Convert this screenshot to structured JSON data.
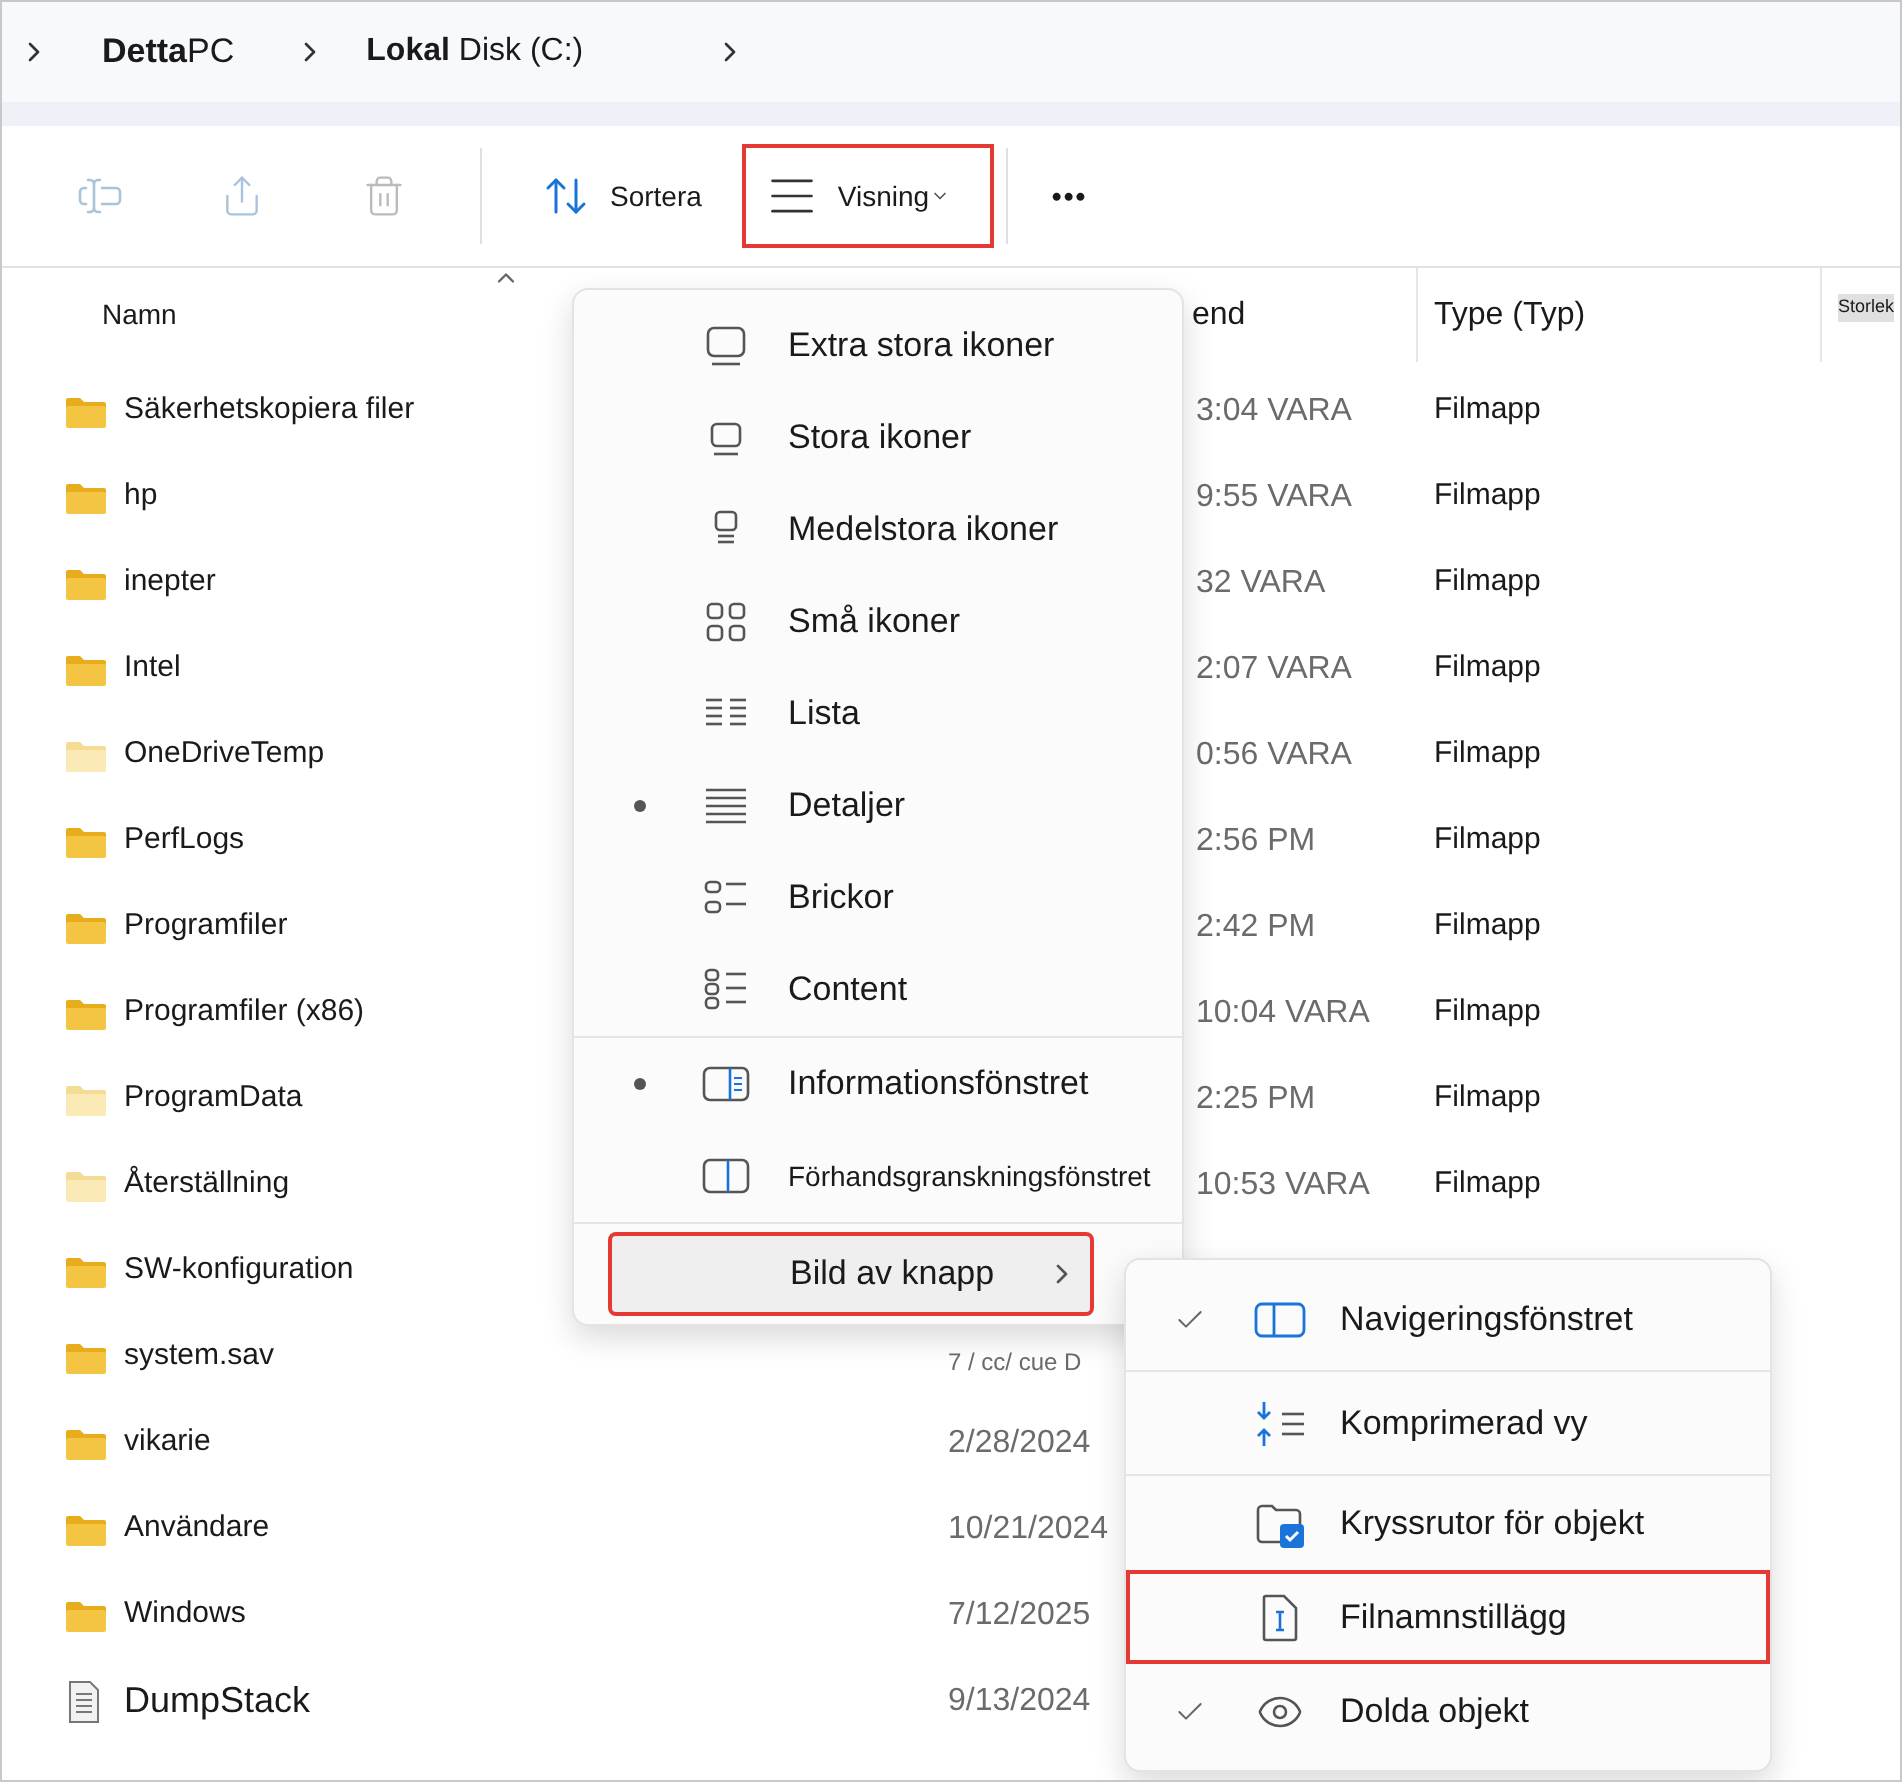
{
  "breadcrumb": [
    {
      "label": "**Detta**PC"
    },
    {
      "label": "**Lokal** Disk (C:)"
    }
  ],
  "toolbar": [
    {
      "kind": "rename",
      "disabled": true
    },
    {
      "kind": "share",
      "disabled": true
    },
    {
      "kind": "delete",
      "disabled": true
    },
    {
      "kind": "sort",
      "label": "Sortera",
      "highlighted": false
    },
    {
      "kind": "view",
      "label": "Visning",
      "highlighted": true
    },
    {
      "kind": "more",
      "label": "•••"
    }
  ],
  "table": {
    "columns": [
      "Namn",
      "end",
      "Type (Typ)",
      "Storlek"
    ],
    "rows": [
      {
        "kind": "folder",
        "hidden": false,
        "name": "Säkerhetskopiera filer",
        "date": "3:04 VARA",
        "type": "Filmapp"
      },
      {
        "kind": "folder",
        "hidden": false,
        "name": "hp",
        "date": "9:55 VARA",
        "type": "Filmapp"
      },
      {
        "kind": "folder",
        "hidden": false,
        "name": "inepter",
        "date": "32 VARA",
        "type": "Filmapp"
      },
      {
        "kind": "folder",
        "hidden": false,
        "name": "Intel",
        "date": "2:07 VARA",
        "type": "Filmapp"
      },
      {
        "kind": "folder",
        "hidden": true,
        "name": "OneDriveTemp",
        "date": "0:56 VARA",
        "type": "Filmapp"
      },
      {
        "kind": "folder",
        "hidden": false,
        "name": "PerfLogs",
        "date": "2:56 PM",
        "type": "Filmapp"
      },
      {
        "kind": "folder",
        "hidden": false,
        "name": "Programfiler",
        "date": "2:42 PM",
        "type": "Filmapp"
      },
      {
        "kind": "folder",
        "hidden": false,
        "name": "Programfiler (x86)",
        "date": "10:04 VARA",
        "type": "Filmapp"
      },
      {
        "kind": "folder",
        "hidden": true,
        "name": "ProgramData",
        "date": "2:25 PM",
        "type": "Filmapp"
      },
      {
        "kind": "folder",
        "hidden": true,
        "name": "Återställning",
        "date": "10:53 VARA",
        "type": "Filmapp"
      },
      {
        "kind": "folder",
        "hidden": false,
        "name": "SW-konfiguration"
      },
      {
        "kind": "folder",
        "hidden": false,
        "name": "system.sav",
        "date": "7 / cc/ cue D"
      },
      {
        "kind": "folder",
        "hidden": false,
        "name": "vikarie",
        "date": "2/28/2024"
      },
      {
        "kind": "folder",
        "hidden": false,
        "name": "Användare",
        "date": "10/21/2024"
      },
      {
        "kind": "folder",
        "hidden": false,
        "name": "Windows",
        "date": "7/12/2025"
      },
      {
        "kind": "file",
        "hidden": false,
        "name": "DumpStack",
        "date": "9/13/2024"
      }
    ]
  },
  "view_menu": {
    "sections": [
      {
        "items": [
          {
            "label": "Extra stora ikoner",
            "selected": false
          },
          {
            "label": "Stora ikoner",
            "selected": false
          },
          {
            "label": "Medelstora ikoner",
            "selected": false
          },
          {
            "label": "Små ikoner",
            "selected": false
          },
          {
            "label": "Lista",
            "selected": false
          },
          {
            "label": "Detaljer",
            "selected": true
          },
          {
            "label": "Brickor",
            "selected": false
          },
          {
            "label": "Content",
            "selected": false
          }
        ]
      },
      {
        "items": [
          {
            "label": "Informationsfönstret",
            "selected": true
          },
          {
            "label": "Förhandsgranskningsfönstret",
            "selected": false
          }
        ]
      }
    ],
    "show_item": {
      "label": "Bild av knapp",
      "highlighted": true
    }
  },
  "show_menu": {
    "sections": [
      {
        "items": [
          {
            "label": "Navigeringsfönstret",
            "checked": true,
            "highlighted": false
          }
        ]
      },
      {
        "items": [
          {
            "label": "Komprimerad vy",
            "checked": false,
            "highlighted": false
          }
        ]
      },
      {
        "items": [
          {
            "label": "Kryssrutor för objekt",
            "checked": false,
            "highlighted": false
          },
          {
            "label": "Filnamnstillägg",
            "checked": false,
            "highlighted": true
          },
          {
            "label": "Dolda objekt",
            "checked": true,
            "highlighted": false
          }
        ]
      }
    ]
  }
}
